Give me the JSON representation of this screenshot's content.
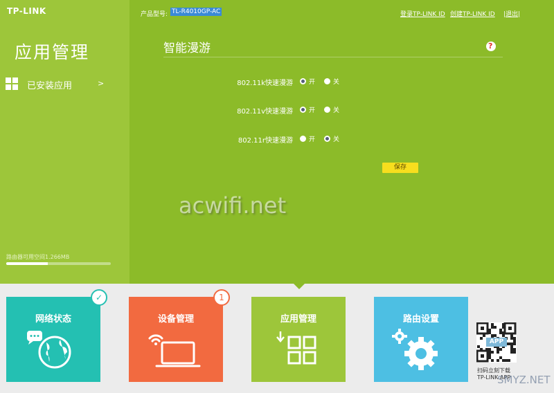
{
  "header": {
    "logo": "TP-LINK",
    "model_label": "产品型号:",
    "model_value": "TL-R4010GP-AC",
    "login_link": "登录TP-LINK ID",
    "create_link": "创建TP-LINK ID",
    "logout_link": "|退出|"
  },
  "sidebar": {
    "title": "应用管理",
    "installed_label": "已安装应用",
    "installed_arrow": ">",
    "storage_text": "路由器可用空间1.266MB",
    "storage_used_fraction": 0.4
  },
  "main": {
    "title": "智能漫游",
    "rows": [
      {
        "label": "802.11k快速漫游",
        "on_label": "开",
        "off_label": "关",
        "selected": "on"
      },
      {
        "label": "802.11v快速漫游",
        "on_label": "开",
        "off_label": "关",
        "selected": "on"
      },
      {
        "label": "802.11r快速漫游",
        "on_label": "开",
        "off_label": "关",
        "selected": "off"
      }
    ],
    "save_label": "保存"
  },
  "watermark": "acwifi.net",
  "tiles": [
    {
      "label": "网络状态",
      "color": "#24c0b2",
      "badge": "✓",
      "icon": "globe-chat-icon"
    },
    {
      "label": "设备管理",
      "color": "#f26a40",
      "badge": "1",
      "icon": "laptop-wifi-icon"
    },
    {
      "label": "应用管理",
      "color": "#9dc63a",
      "badge": "",
      "icon": "app-grid-icon"
    },
    {
      "label": "路由设置",
      "color": "#4dbfe3",
      "badge": "",
      "icon": "gears-icon"
    }
  ],
  "qr": {
    "badge": "APP",
    "text1": "扫码立刻下载",
    "text2": "TP-LINK APP"
  },
  "smyz_watermark": "SMYZ.NET"
}
